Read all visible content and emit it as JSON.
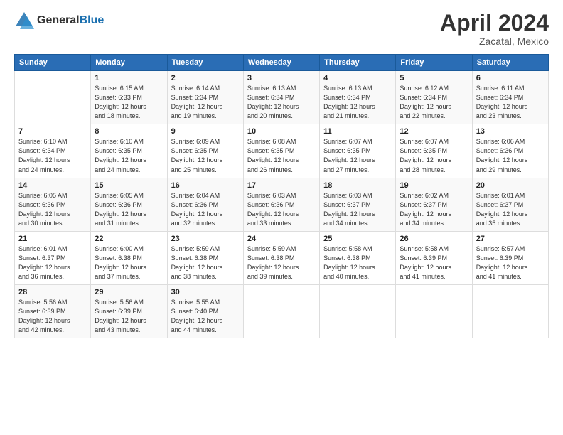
{
  "header": {
    "logo_line1": "General",
    "logo_line2": "Blue",
    "month": "April 2024",
    "location": "Zacatal, Mexico"
  },
  "weekdays": [
    "Sunday",
    "Monday",
    "Tuesday",
    "Wednesday",
    "Thursday",
    "Friday",
    "Saturday"
  ],
  "weeks": [
    [
      {
        "day": "",
        "info": ""
      },
      {
        "day": "1",
        "info": "Sunrise: 6:15 AM\nSunset: 6:33 PM\nDaylight: 12 hours\nand 18 minutes."
      },
      {
        "day": "2",
        "info": "Sunrise: 6:14 AM\nSunset: 6:34 PM\nDaylight: 12 hours\nand 19 minutes."
      },
      {
        "day": "3",
        "info": "Sunrise: 6:13 AM\nSunset: 6:34 PM\nDaylight: 12 hours\nand 20 minutes."
      },
      {
        "day": "4",
        "info": "Sunrise: 6:13 AM\nSunset: 6:34 PM\nDaylight: 12 hours\nand 21 minutes."
      },
      {
        "day": "5",
        "info": "Sunrise: 6:12 AM\nSunset: 6:34 PM\nDaylight: 12 hours\nand 22 minutes."
      },
      {
        "day": "6",
        "info": "Sunrise: 6:11 AM\nSunset: 6:34 PM\nDaylight: 12 hours\nand 23 minutes."
      }
    ],
    [
      {
        "day": "7",
        "info": "Sunrise: 6:10 AM\nSunset: 6:34 PM\nDaylight: 12 hours\nand 24 minutes."
      },
      {
        "day": "8",
        "info": "Sunrise: 6:10 AM\nSunset: 6:35 PM\nDaylight: 12 hours\nand 24 minutes."
      },
      {
        "day": "9",
        "info": "Sunrise: 6:09 AM\nSunset: 6:35 PM\nDaylight: 12 hours\nand 25 minutes."
      },
      {
        "day": "10",
        "info": "Sunrise: 6:08 AM\nSunset: 6:35 PM\nDaylight: 12 hours\nand 26 minutes."
      },
      {
        "day": "11",
        "info": "Sunrise: 6:07 AM\nSunset: 6:35 PM\nDaylight: 12 hours\nand 27 minutes."
      },
      {
        "day": "12",
        "info": "Sunrise: 6:07 AM\nSunset: 6:35 PM\nDaylight: 12 hours\nand 28 minutes."
      },
      {
        "day": "13",
        "info": "Sunrise: 6:06 AM\nSunset: 6:36 PM\nDaylight: 12 hours\nand 29 minutes."
      }
    ],
    [
      {
        "day": "14",
        "info": "Sunrise: 6:05 AM\nSunset: 6:36 PM\nDaylight: 12 hours\nand 30 minutes."
      },
      {
        "day": "15",
        "info": "Sunrise: 6:05 AM\nSunset: 6:36 PM\nDaylight: 12 hours\nand 31 minutes."
      },
      {
        "day": "16",
        "info": "Sunrise: 6:04 AM\nSunset: 6:36 PM\nDaylight: 12 hours\nand 32 minutes."
      },
      {
        "day": "17",
        "info": "Sunrise: 6:03 AM\nSunset: 6:36 PM\nDaylight: 12 hours\nand 33 minutes."
      },
      {
        "day": "18",
        "info": "Sunrise: 6:03 AM\nSunset: 6:37 PM\nDaylight: 12 hours\nand 34 minutes."
      },
      {
        "day": "19",
        "info": "Sunrise: 6:02 AM\nSunset: 6:37 PM\nDaylight: 12 hours\nand 34 minutes."
      },
      {
        "day": "20",
        "info": "Sunrise: 6:01 AM\nSunset: 6:37 PM\nDaylight: 12 hours\nand 35 minutes."
      }
    ],
    [
      {
        "day": "21",
        "info": "Sunrise: 6:01 AM\nSunset: 6:37 PM\nDaylight: 12 hours\nand 36 minutes."
      },
      {
        "day": "22",
        "info": "Sunrise: 6:00 AM\nSunset: 6:38 PM\nDaylight: 12 hours\nand 37 minutes."
      },
      {
        "day": "23",
        "info": "Sunrise: 5:59 AM\nSunset: 6:38 PM\nDaylight: 12 hours\nand 38 minutes."
      },
      {
        "day": "24",
        "info": "Sunrise: 5:59 AM\nSunset: 6:38 PM\nDaylight: 12 hours\nand 39 minutes."
      },
      {
        "day": "25",
        "info": "Sunrise: 5:58 AM\nSunset: 6:38 PM\nDaylight: 12 hours\nand 40 minutes."
      },
      {
        "day": "26",
        "info": "Sunrise: 5:58 AM\nSunset: 6:39 PM\nDaylight: 12 hours\nand 41 minutes."
      },
      {
        "day": "27",
        "info": "Sunrise: 5:57 AM\nSunset: 6:39 PM\nDaylight: 12 hours\nand 41 minutes."
      }
    ],
    [
      {
        "day": "28",
        "info": "Sunrise: 5:56 AM\nSunset: 6:39 PM\nDaylight: 12 hours\nand 42 minutes."
      },
      {
        "day": "29",
        "info": "Sunrise: 5:56 AM\nSunset: 6:39 PM\nDaylight: 12 hours\nand 43 minutes."
      },
      {
        "day": "30",
        "info": "Sunrise: 5:55 AM\nSunset: 6:40 PM\nDaylight: 12 hours\nand 44 minutes."
      },
      {
        "day": "",
        "info": ""
      },
      {
        "day": "",
        "info": ""
      },
      {
        "day": "",
        "info": ""
      },
      {
        "day": "",
        "info": ""
      }
    ]
  ]
}
